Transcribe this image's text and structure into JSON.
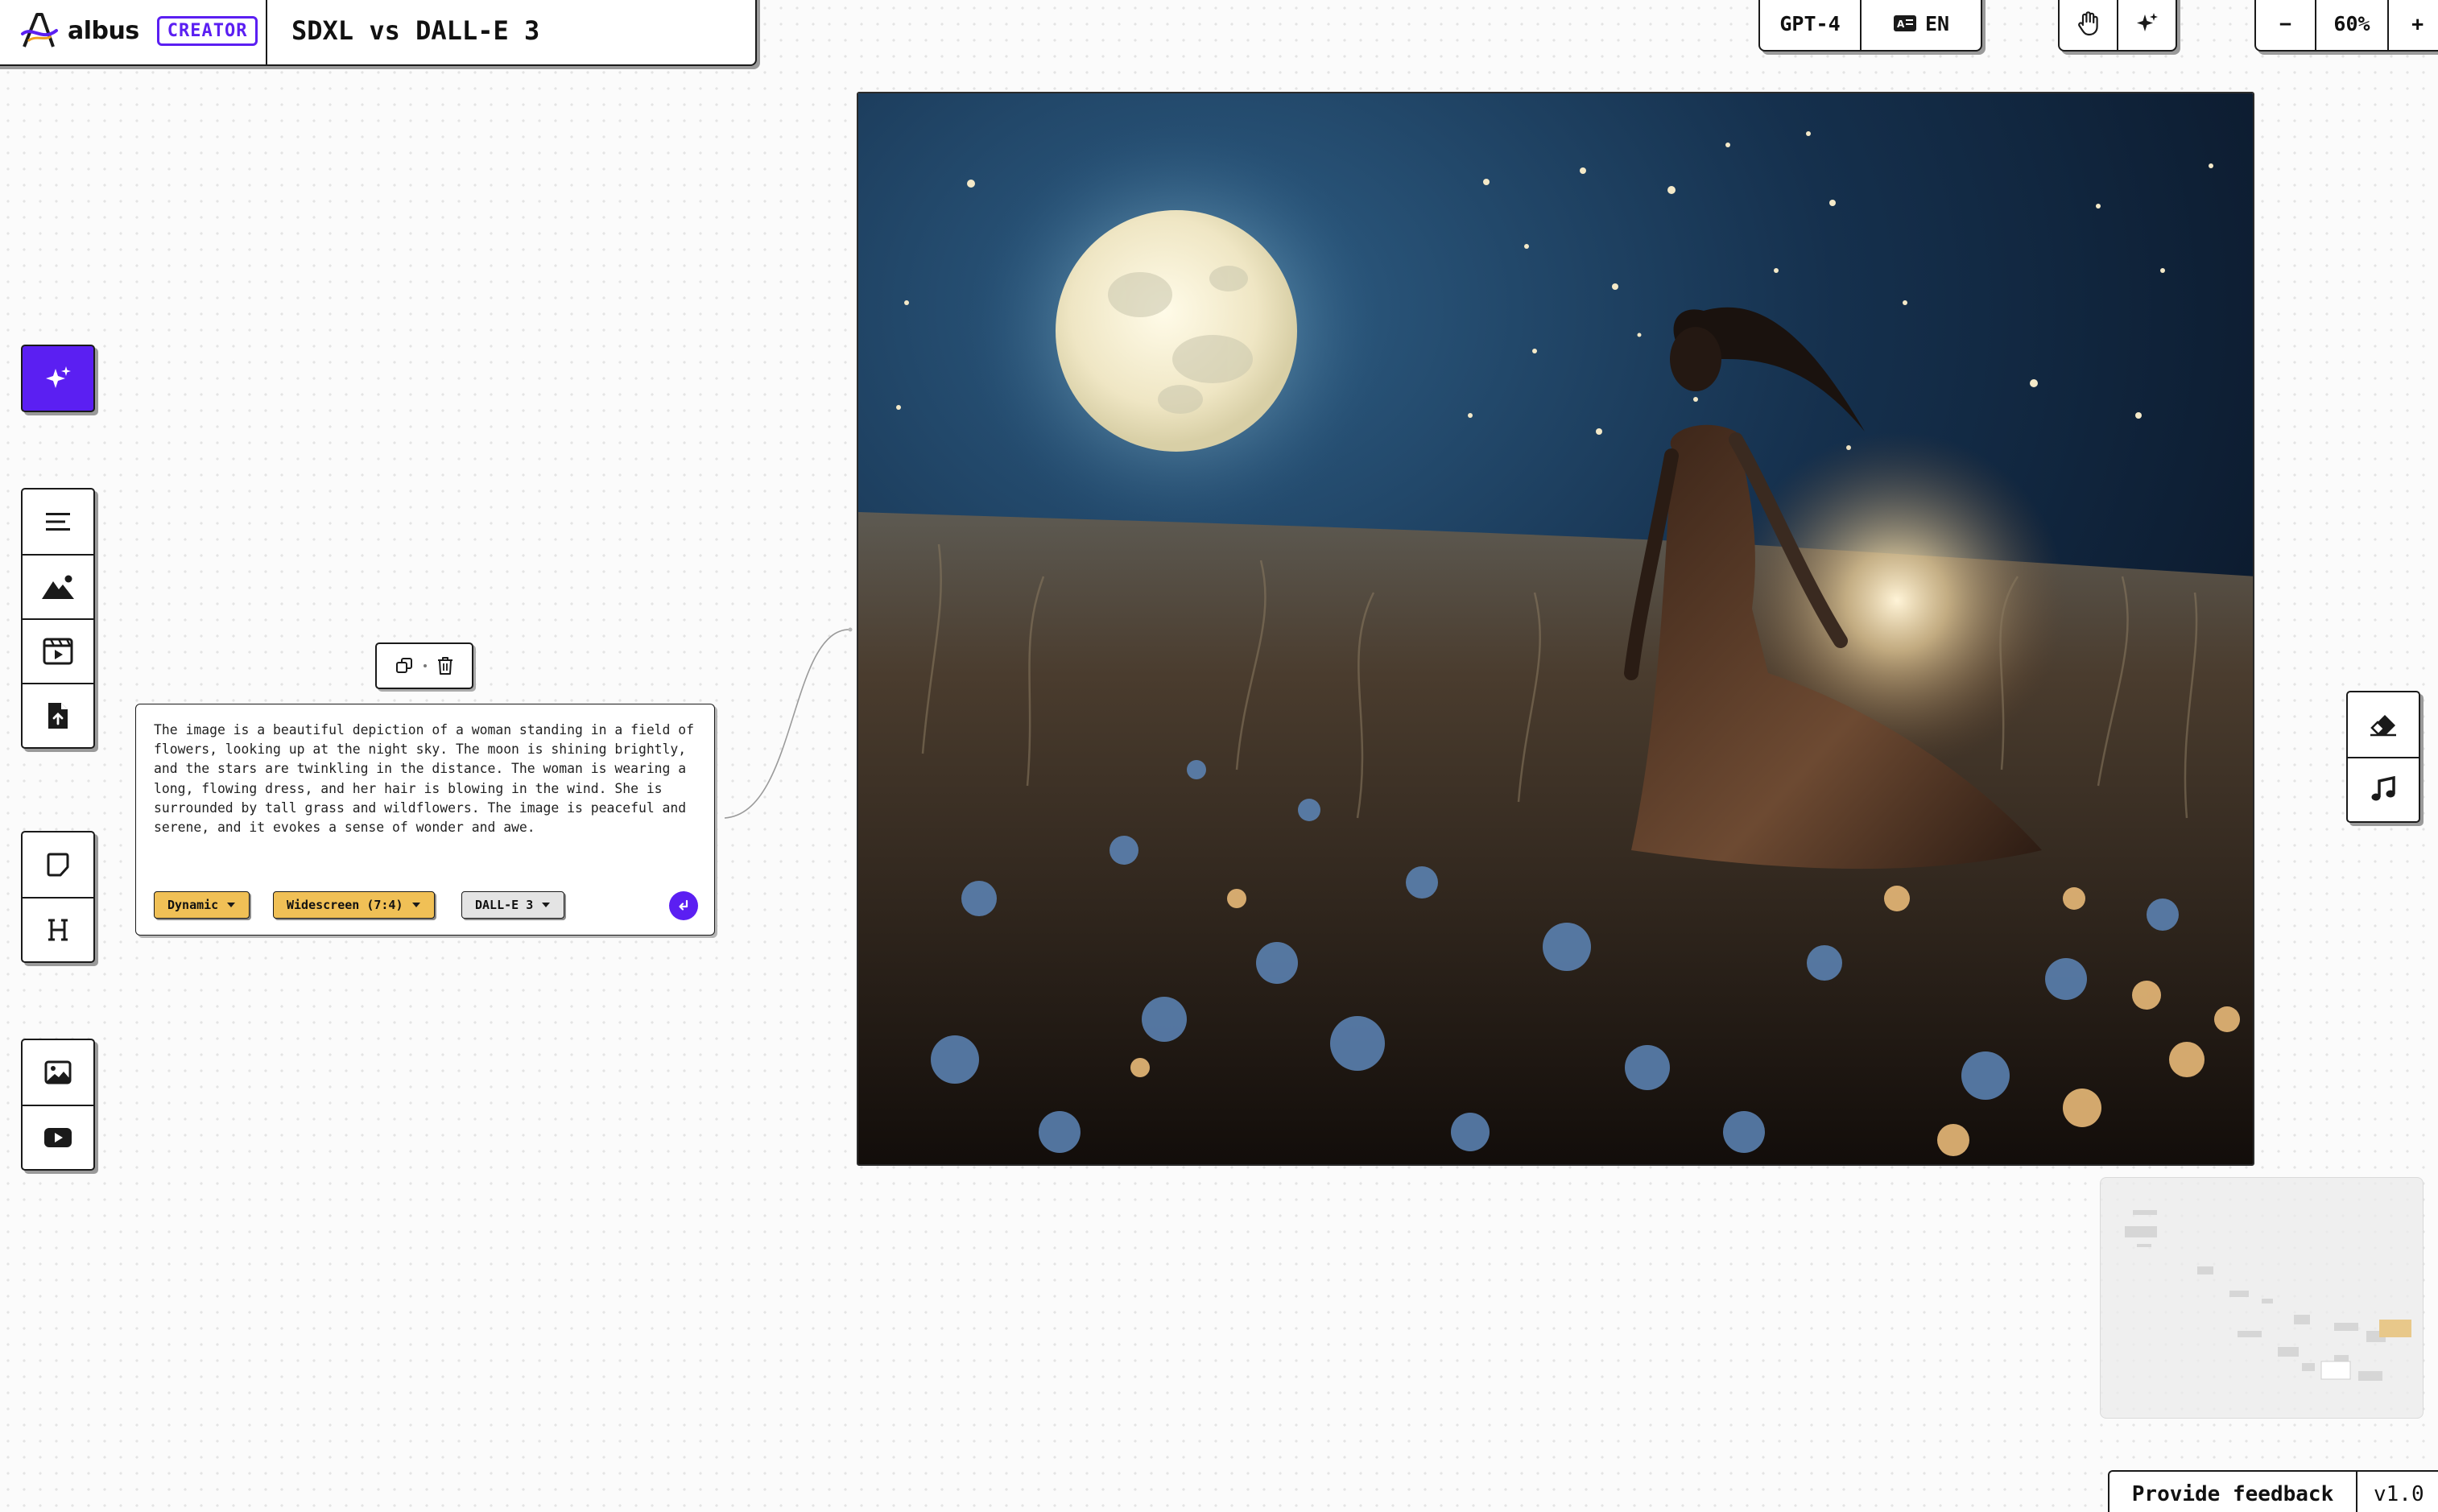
{
  "header": {
    "app_name": "albus",
    "plan_badge": "CREATOR",
    "document_title": "SDXL vs DALL-E 3"
  },
  "toolbar_top": {
    "model": "GPT-4",
    "language": "EN",
    "zoom_minus": "−",
    "zoom_level": "60%",
    "zoom_plus": "+"
  },
  "prompt_card": {
    "text": "The image is a beautiful depiction of a woman standing in a field of flowers, looking up at the night sky. The moon is shining brightly, and the stars are twinkling in the distance. The woman is wearing a long, flowing dress, and her hair is blowing in the wind. She is surrounded by tall grass and wildflowers. The image is peaceful and serene, and it evokes a sense of wonder and awe.",
    "style_option": "Dynamic",
    "ratio_option": "Widescreen (7:4)",
    "model_option": "DALL-E 3"
  },
  "footer": {
    "feedback_label": "Provide feedback",
    "version": "v1.0"
  },
  "colors": {
    "accent": "#5b1ff2",
    "chip_yellow": "#f0c056",
    "chip_gray": "#e4e4e4"
  },
  "icons": {
    "left_ai": "sparkles-icon",
    "left_group1": [
      "text-lines-icon",
      "image-mountain-icon",
      "video-clapper-icon",
      "file-upload-icon"
    ],
    "left_group2": [
      "sticky-note-icon",
      "heading-icon"
    ],
    "left_group3": [
      "picture-icon",
      "youtube-icon"
    ],
    "right_group": [
      "eraser-icon",
      "music-note-icon"
    ],
    "top_tools": [
      "hand-pan-icon",
      "magic-sparkle-icon"
    ]
  }
}
